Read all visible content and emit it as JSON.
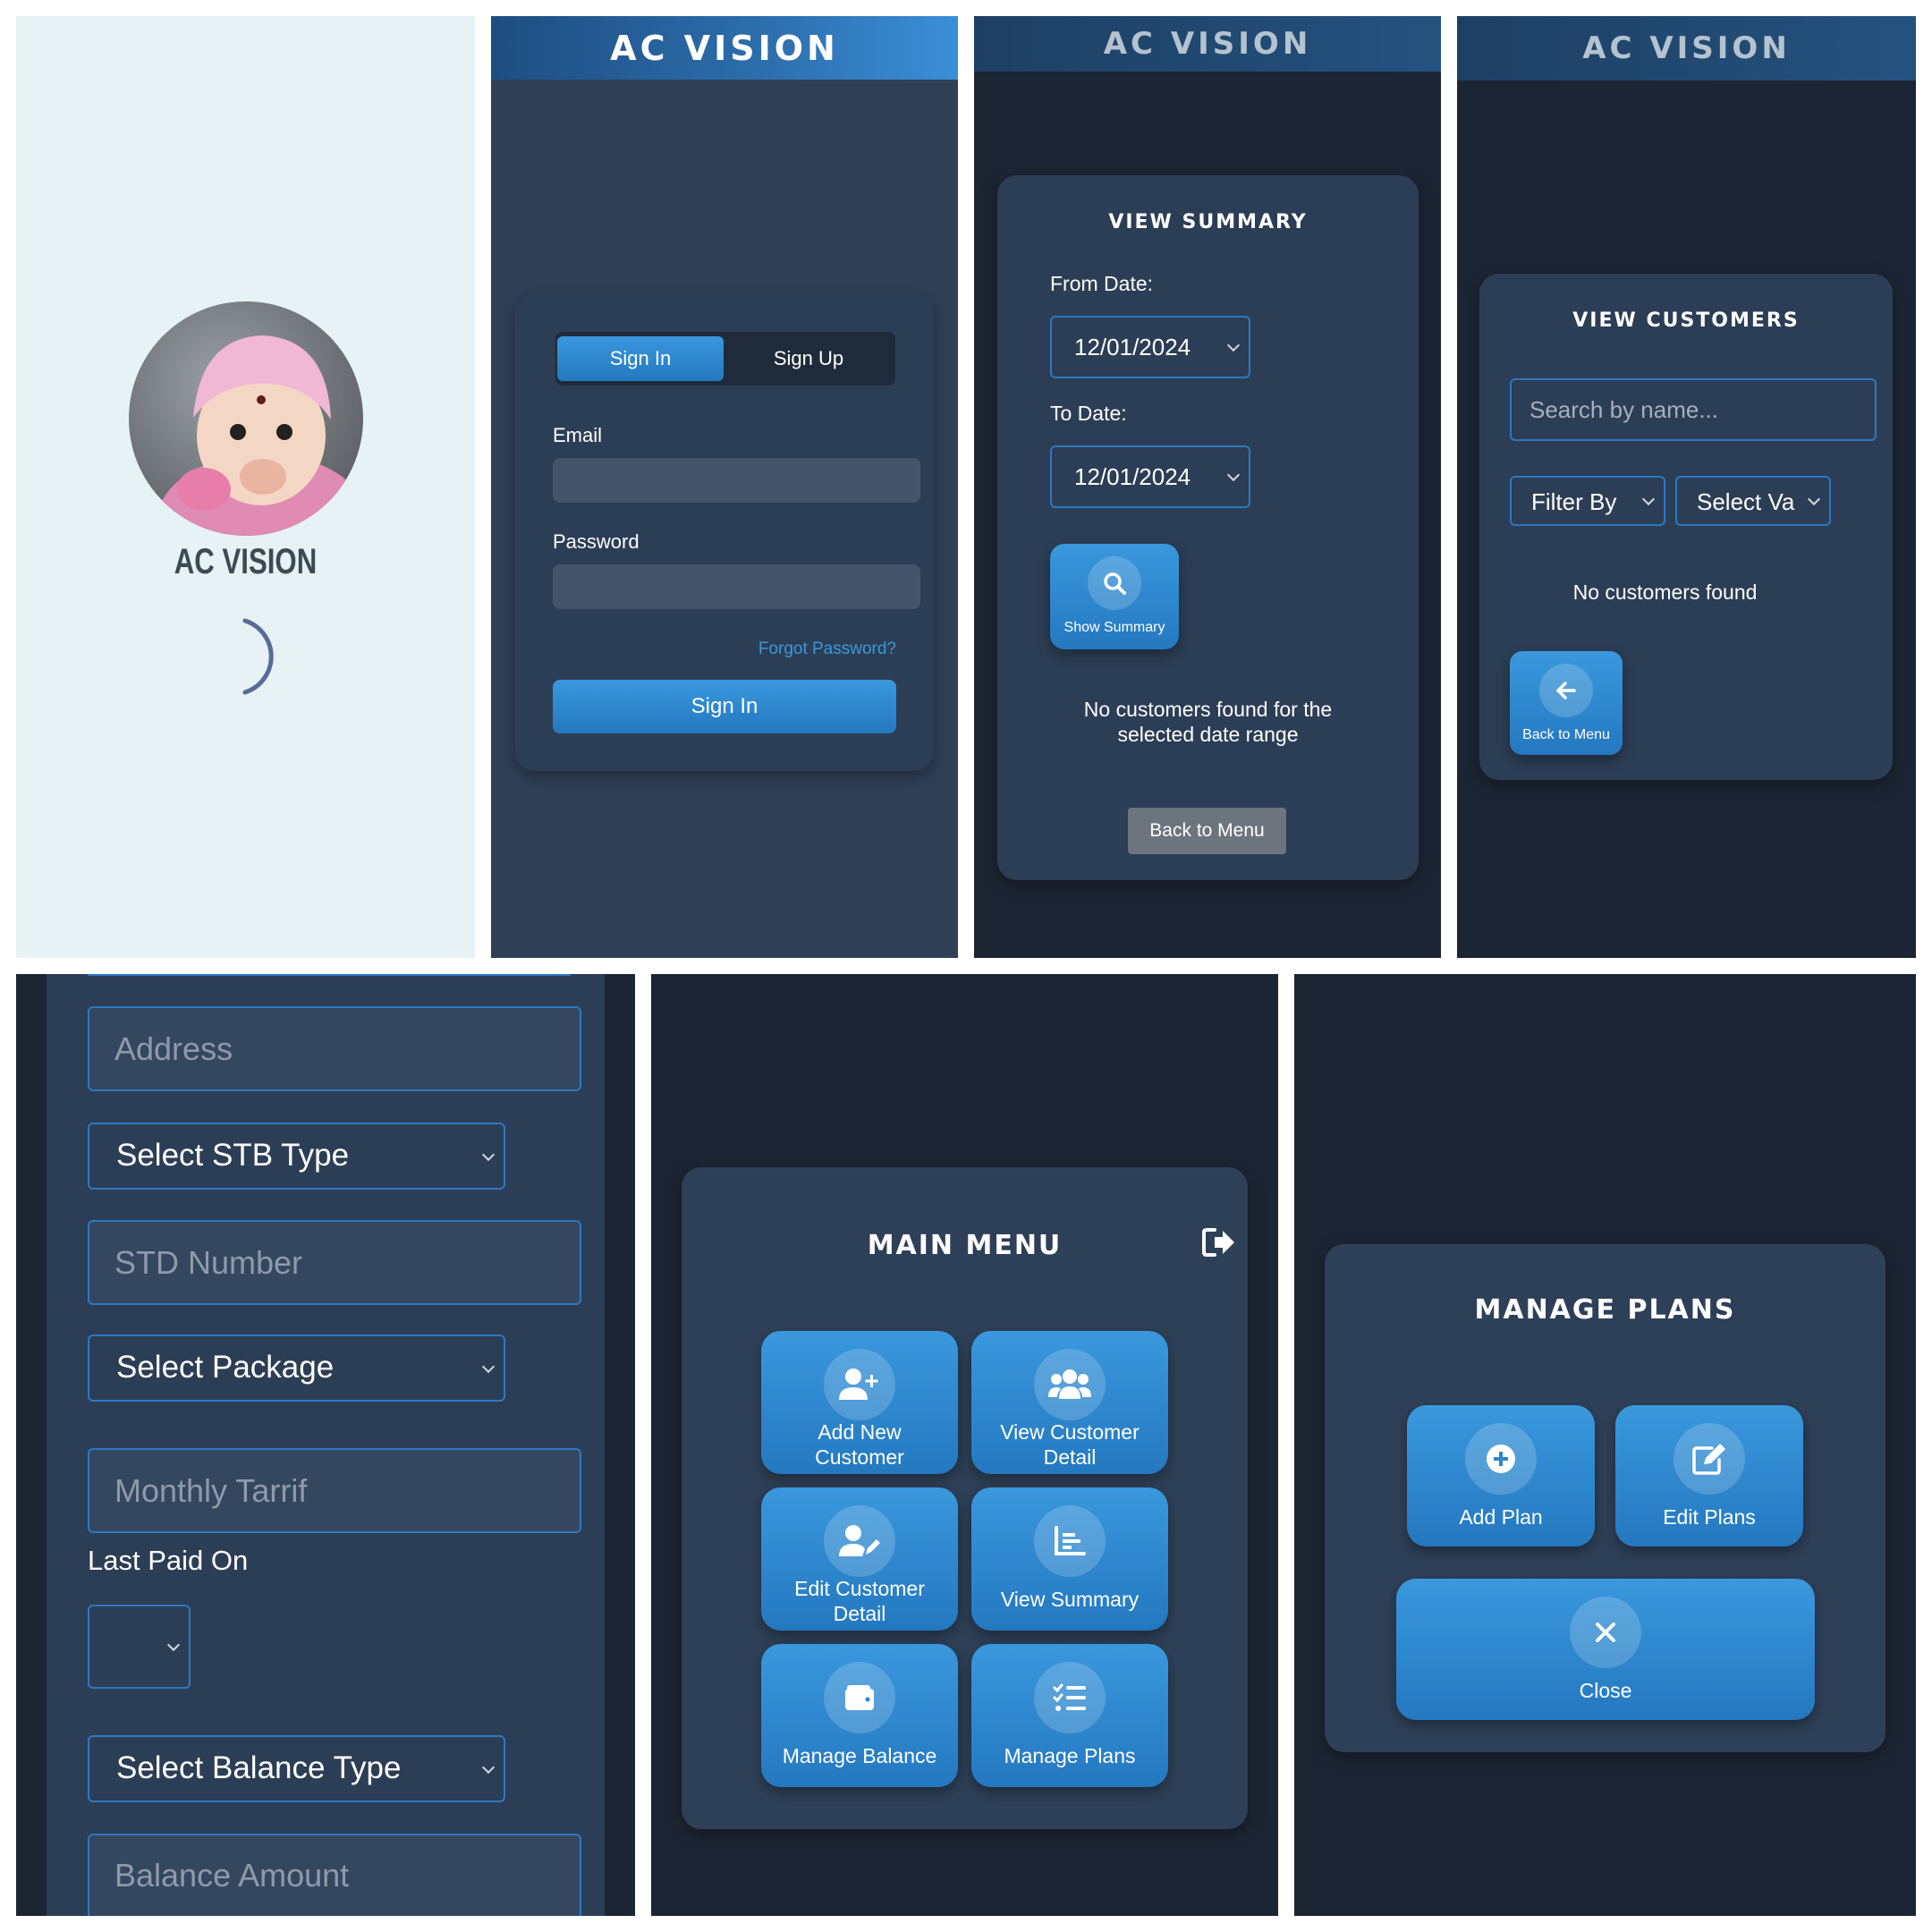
{
  "splash": {
    "app_name": "AC VISION"
  },
  "login": {
    "header_title": "AC VISION",
    "tabs": [
      "Sign In",
      "Sign Up"
    ],
    "email_label": "Email",
    "password_label": "Password",
    "forgot_link": "Forgot Password?",
    "submit_label": "Sign In"
  },
  "summary": {
    "header_title": "AC VISION",
    "title": "VIEW SUMMARY",
    "from_label": "From Date:",
    "from_value": "12/01/2024",
    "to_label": "To Date:",
    "to_value": "12/01/2024",
    "show_button": "Show Summary",
    "empty_message_line1": "No customers found for the",
    "empty_message_line2": "selected date range",
    "back_button": "Back to Menu"
  },
  "customers": {
    "header_title": "AC VISION",
    "title": "VIEW CUSTOMERS",
    "search_placeholder": "Search by name...",
    "filter_select": "Filter By",
    "value_select": "Select Va",
    "empty_message": "No customers found",
    "back_button": "Back to Menu"
  },
  "form": {
    "address_placeholder": "Address",
    "stb_select": "Select STB Type",
    "std_placeholder": "STD Number",
    "package_select": "Select Package",
    "tariff_placeholder": "Monthly Tarrif",
    "last_paid_label": "Last Paid On",
    "balance_type_select": "Select Balance Type",
    "balance_amount_placeholder": "Balance Amount"
  },
  "main_menu": {
    "title": "MAIN MENU",
    "buttons": [
      {
        "line1": "Add New",
        "line2": "Customer",
        "icon": "user-plus-icon"
      },
      {
        "line1": "View Customer",
        "line2": "Detail",
        "icon": "users-icon"
      },
      {
        "line1": "Edit Customer",
        "line2": "Detail",
        "icon": "user-edit-icon"
      },
      {
        "line1": "View Summary",
        "line2": "",
        "icon": "chart-icon"
      },
      {
        "line1": "Manage Balance",
        "line2": "",
        "icon": "wallet-icon"
      },
      {
        "line1": "Manage Plans",
        "line2": "",
        "icon": "list-check-icon"
      }
    ]
  },
  "plans": {
    "title": "MANAGE PLANS",
    "add_button": "Add Plan",
    "edit_button": "Edit Plans",
    "close_button": "Close"
  },
  "colors": {
    "accent": "#2e8bd6",
    "panel_dark": "#1c2533",
    "card": "#2c3e55"
  }
}
